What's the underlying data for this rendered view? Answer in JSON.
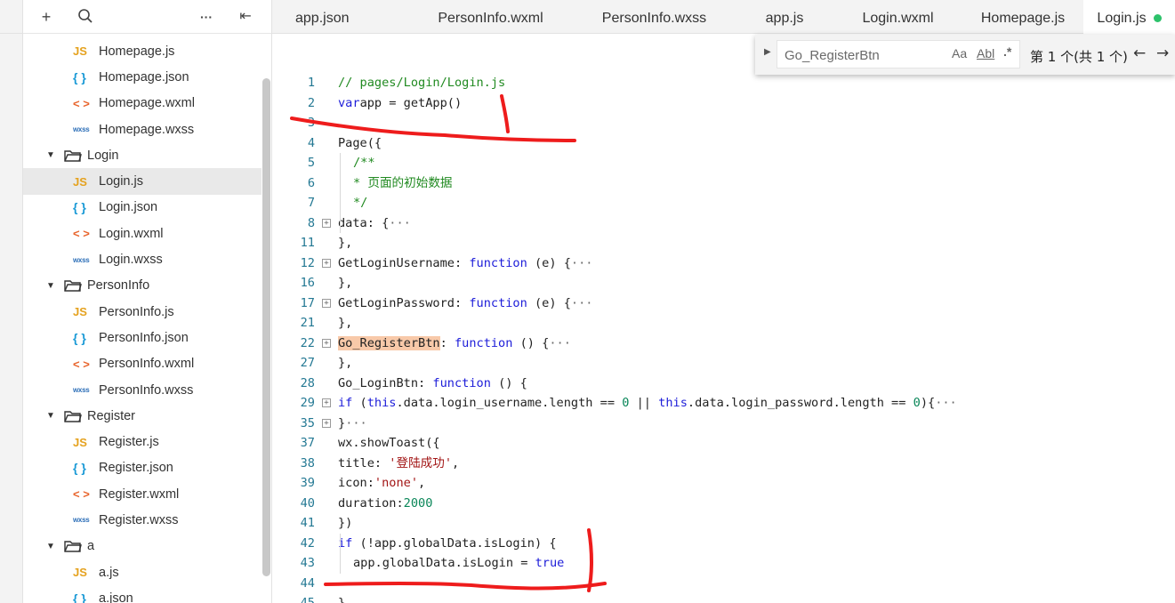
{
  "toolbar": {
    "add_icon": "plus-icon",
    "search_icon": "search-icon",
    "more_icon": "ellipsis-icon",
    "collapse_icon": "collapse-icon",
    "add": "+",
    "more": "···",
    "collapse": "⇤"
  },
  "tree": [
    {
      "type": "file",
      "icon": "js",
      "badge": "JS",
      "label": "Homepage.js"
    },
    {
      "type": "file",
      "icon": "json",
      "badge": "{ }",
      "label": "Homepage.json"
    },
    {
      "type": "file",
      "icon": "wxml",
      "badge": "< >",
      "label": "Homepage.wxml"
    },
    {
      "type": "file",
      "icon": "wxss",
      "badge": "wxss",
      "label": "Homepage.wxss"
    },
    {
      "type": "folder",
      "label": "Login"
    },
    {
      "type": "file",
      "icon": "js",
      "badge": "JS",
      "label": "Login.js",
      "selected": true
    },
    {
      "type": "file",
      "icon": "json",
      "badge": "{ }",
      "label": "Login.json"
    },
    {
      "type": "file",
      "icon": "wxml",
      "badge": "< >",
      "label": "Login.wxml"
    },
    {
      "type": "file",
      "icon": "wxss",
      "badge": "wxss",
      "label": "Login.wxss"
    },
    {
      "type": "folder",
      "label": "PersonInfo"
    },
    {
      "type": "file",
      "icon": "js",
      "badge": "JS",
      "label": "PersonInfo.js"
    },
    {
      "type": "file",
      "icon": "json",
      "badge": "{ }",
      "label": "PersonInfo.json"
    },
    {
      "type": "file",
      "icon": "wxml",
      "badge": "< >",
      "label": "PersonInfo.wxml"
    },
    {
      "type": "file",
      "icon": "wxss",
      "badge": "wxss",
      "label": "PersonInfo.wxss"
    },
    {
      "type": "folder",
      "label": "Register"
    },
    {
      "type": "file",
      "icon": "js",
      "badge": "JS",
      "label": "Register.js"
    },
    {
      "type": "file",
      "icon": "json",
      "badge": "{ }",
      "label": "Register.json"
    },
    {
      "type": "file",
      "icon": "wxml",
      "badge": "< >",
      "label": "Register.wxml"
    },
    {
      "type": "file",
      "icon": "wxss",
      "badge": "wxss",
      "label": "Register.wxss"
    },
    {
      "type": "folder",
      "label": "a"
    },
    {
      "type": "file",
      "icon": "js",
      "badge": "JS",
      "label": "a.js"
    },
    {
      "type": "file",
      "icon": "json",
      "badge": "{ }",
      "label": "a.json"
    }
  ],
  "tabs": [
    {
      "label": "app.json"
    },
    {
      "label": "PersonInfo.wxml"
    },
    {
      "label": "PersonInfo.wxss"
    },
    {
      "label": "app.js"
    },
    {
      "label": "Login.wxml"
    },
    {
      "label": "Homepage.js"
    },
    {
      "label": "Login.js",
      "active": true
    }
  ],
  "find": {
    "value": "Go_RegisterBtn",
    "match_case": "Aa",
    "whole_word": "Abl",
    "regex": ".*",
    "count": "第 1 个(共 1 个)",
    "prev": "←",
    "next": "→"
  },
  "colors": {
    "accent": "#2dc26b",
    "line_number": "#237893",
    "keyword": "#1d1dd9",
    "string": "#a21515",
    "comment": "#218a21",
    "number": "#098658",
    "highlight": "#f8c9a9",
    "annotation": "#ee1c1c"
  },
  "code": [
    {
      "n": "1",
      "fold": false,
      "indent": 0,
      "tokens": [
        [
          "cm",
          "// pages/Login/Login.js"
        ]
      ]
    },
    {
      "n": "2",
      "fold": false,
      "indent": 0,
      "tokens": [
        [
          "kw",
          "var"
        ],
        [
          "",
          "app = getApp()"
        ]
      ]
    },
    {
      "n": "3",
      "fold": false,
      "indent": 0,
      "tokens": []
    },
    {
      "n": "4",
      "fold": false,
      "indent": 0,
      "tokens": [
        [
          "",
          "Page({"
        ]
      ]
    },
    {
      "n": "5",
      "fold": false,
      "indent": 1,
      "tokens": [
        [
          "cm",
          "/**"
        ]
      ]
    },
    {
      "n": "6",
      "fold": false,
      "indent": 1,
      "tokens": [
        [
          "cm",
          "* 页面的初始数据"
        ]
      ]
    },
    {
      "n": "7",
      "fold": false,
      "indent": 1,
      "tokens": [
        [
          "cm",
          "*/"
        ]
      ]
    },
    {
      "n": "8",
      "fold": true,
      "indent": 0,
      "tokens": [
        [
          "",
          "data: {"
        ],
        [
          "ell",
          "···"
        ]
      ]
    },
    {
      "n": "11",
      "fold": false,
      "indent": 0,
      "tokens": [
        [
          "",
          "},"
        ]
      ]
    },
    {
      "n": "12",
      "fold": true,
      "indent": 0,
      "tokens": [
        [
          "",
          "GetLoginUsername: "
        ],
        [
          "kw",
          "function"
        ],
        [
          "",
          " (e) {"
        ],
        [
          "ell",
          "···"
        ]
      ]
    },
    {
      "n": "16",
      "fold": false,
      "indent": 0,
      "tokens": [
        [
          "",
          "},"
        ]
      ]
    },
    {
      "n": "17",
      "fold": true,
      "indent": 0,
      "tokens": [
        [
          "",
          "GetLoginPassword: "
        ],
        [
          "kw",
          "function"
        ],
        [
          "",
          " (e) {"
        ],
        [
          "ell",
          "···"
        ]
      ]
    },
    {
      "n": "21",
      "fold": false,
      "indent": 0,
      "tokens": [
        [
          "",
          "},"
        ]
      ]
    },
    {
      "n": "22",
      "fold": true,
      "indent": 0,
      "tokens": [
        [
          "hl",
          "Go_RegisterBtn"
        ],
        [
          "",
          ": "
        ],
        [
          "kw",
          "function"
        ],
        [
          "",
          " () {"
        ],
        [
          "ell",
          "···"
        ]
      ]
    },
    {
      "n": "27",
      "fold": false,
      "indent": 0,
      "tokens": [
        [
          "",
          "},"
        ]
      ]
    },
    {
      "n": "28",
      "fold": false,
      "indent": 0,
      "tokens": [
        [
          "",
          "Go_LoginBtn: "
        ],
        [
          "kw",
          "function"
        ],
        [
          "",
          " () {"
        ]
      ]
    },
    {
      "n": "29",
      "fold": true,
      "indent": 0,
      "tokens": [
        [
          "kw",
          "if"
        ],
        [
          "",
          " ("
        ],
        [
          "kw",
          "this"
        ],
        [
          "",
          ".data.login_username.length == "
        ],
        [
          "num",
          "0"
        ],
        [
          "",
          " || "
        ],
        [
          "kw",
          "this"
        ],
        [
          "",
          ".data.login_password.length == "
        ],
        [
          "num",
          "0"
        ],
        [
          "",
          "){"
        ],
        [
          "ell",
          "···"
        ]
      ]
    },
    {
      "n": "35",
      "fold": true,
      "indent": 0,
      "tokens": [
        [
          "",
          "}"
        ],
        [
          "ell",
          "···"
        ]
      ]
    },
    {
      "n": "37",
      "fold": false,
      "indent": 0,
      "tokens": [
        [
          "",
          "wx.showToast({"
        ]
      ]
    },
    {
      "n": "38",
      "fold": false,
      "indent": 0,
      "tokens": [
        [
          "",
          "title: "
        ],
        [
          "str",
          "'登陆成功'"
        ],
        [
          "",
          ","
        ]
      ]
    },
    {
      "n": "39",
      "fold": false,
      "indent": 0,
      "tokens": [
        [
          "",
          "icon:"
        ],
        [
          "str",
          "'none'"
        ],
        [
          "",
          ","
        ]
      ]
    },
    {
      "n": "40",
      "fold": false,
      "indent": 0,
      "tokens": [
        [
          "",
          "duration:"
        ],
        [
          "num",
          "2000"
        ]
      ]
    },
    {
      "n": "41",
      "fold": false,
      "indent": 0,
      "tokens": [
        [
          "",
          "})"
        ]
      ]
    },
    {
      "n": "42",
      "fold": false,
      "indent": 0,
      "tokens": [
        [
          "kw",
          "if"
        ],
        [
          "",
          " (!app.globalData.isLogin) {"
        ]
      ]
    },
    {
      "n": "43",
      "fold": false,
      "indent": 1,
      "tokens": [
        [
          "",
          "app.globalData.isLogin = "
        ],
        [
          "kw",
          "true"
        ]
      ]
    },
    {
      "n": "44",
      "fold": false,
      "indent": 0,
      "tokens": []
    },
    {
      "n": "45",
      "fold": false,
      "indent": 0,
      "tokens": [
        [
          "",
          "}"
        ]
      ]
    }
  ]
}
